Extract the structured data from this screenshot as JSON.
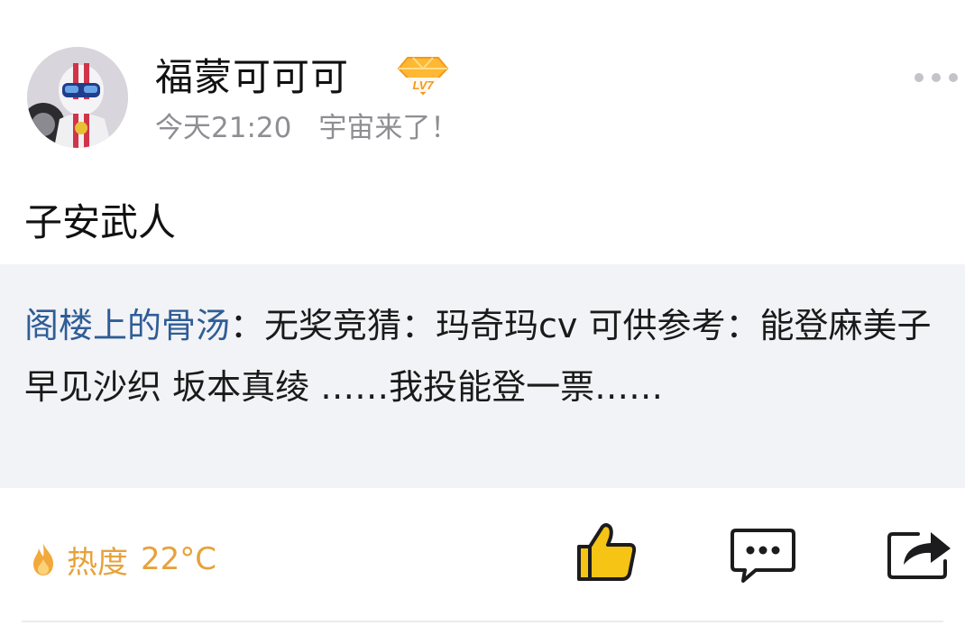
{
  "post": {
    "author": "福蒙可可可",
    "level_badge": "LV7",
    "time": "今天21:20",
    "source": "宇宙来了！",
    "text": "子安武人"
  },
  "quote": {
    "author": "阁楼上的骨汤",
    "separator": "：",
    "content": "无奖竞猜：玛奇玛cv 可供参考：能登麻美子 早见沙织 坂本真绫 ……我投能登一票……"
  },
  "footer": {
    "heat_label": "热度",
    "heat_value": "22°C"
  },
  "icons": {
    "more": "more-dots-icon",
    "level": "diamond-level-badge-icon",
    "heat": "flame-icon",
    "like": "thumbs-up-icon",
    "comment": "comment-bubble-icon",
    "share": "share-arrow-icon"
  },
  "colors": {
    "quote_author": "#2f5d96",
    "heat": "#e7a23a",
    "like_fill": "#f6c415",
    "meta_gray": "#8e8e93",
    "quote_background": "#f2f3f7"
  }
}
